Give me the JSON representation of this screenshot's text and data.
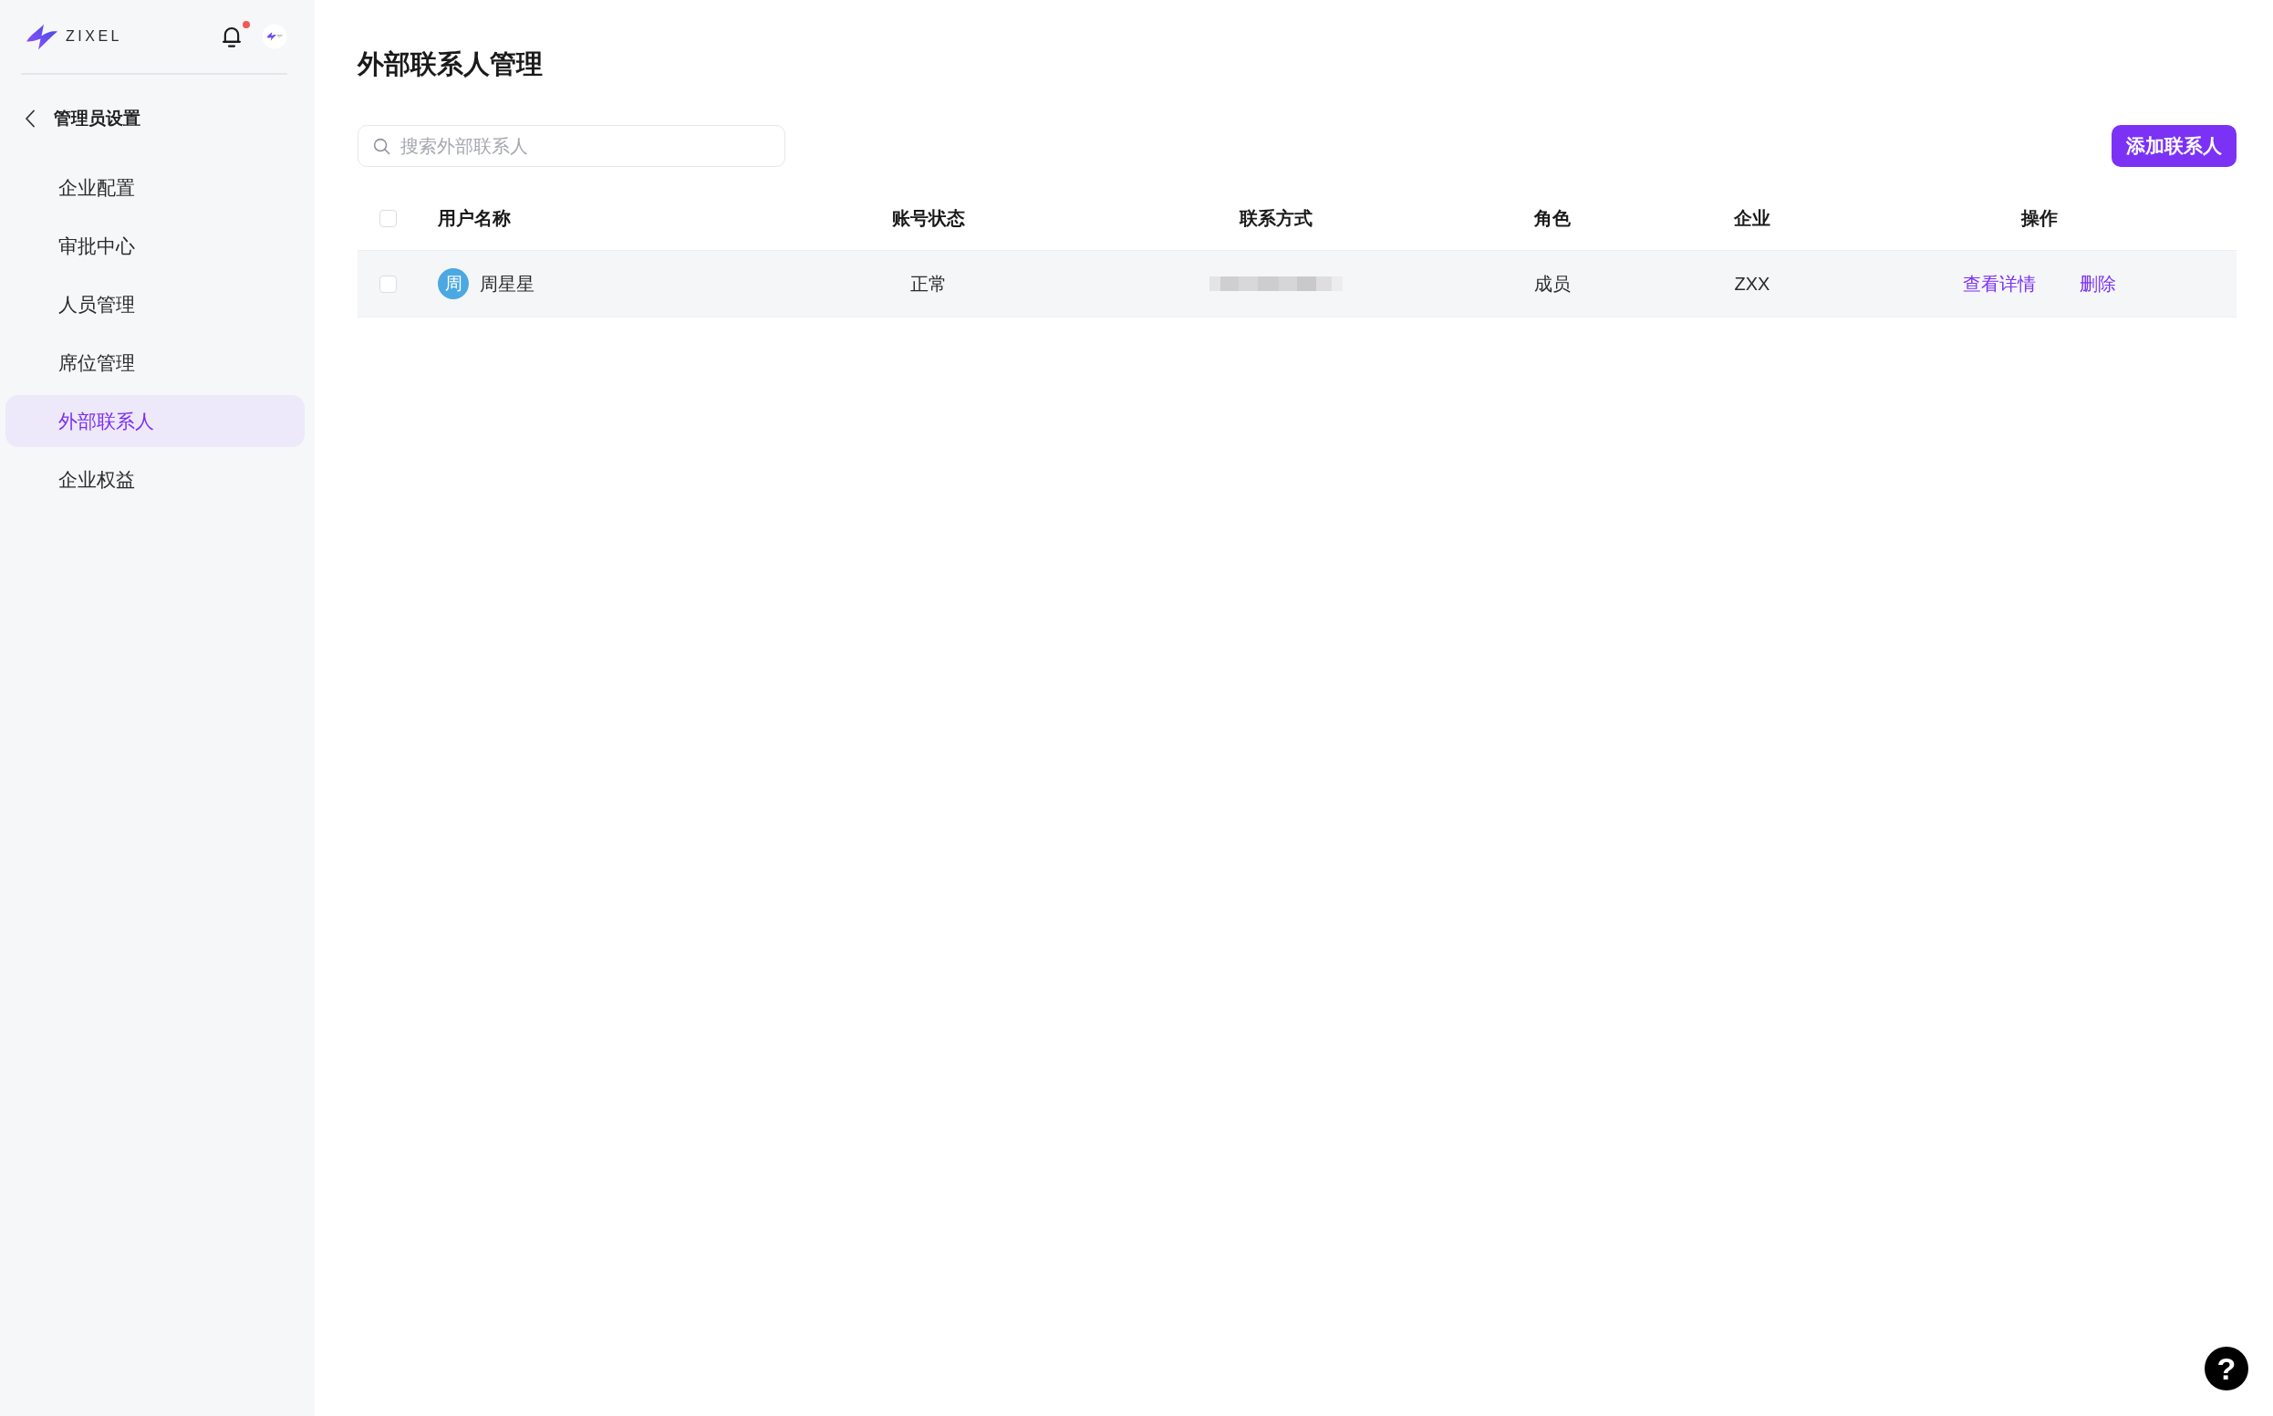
{
  "sidebar": {
    "logo": {
      "wordmark": "ZIXEL"
    },
    "notifications": {
      "unread": true
    },
    "back": {
      "label": "管理员设置"
    },
    "items": [
      {
        "label": "企业配置",
        "selected": false
      },
      {
        "label": "审批中心",
        "selected": false
      },
      {
        "label": "人员管理",
        "selected": false
      },
      {
        "label": "席位管理",
        "selected": false
      },
      {
        "label": "外部联系人",
        "selected": true
      },
      {
        "label": "企业权益",
        "selected": false
      }
    ]
  },
  "page": {
    "title": "外部联系人管理"
  },
  "toolbar": {
    "search": {
      "placeholder": "搜索外部联系人"
    },
    "add_button": {
      "label": "添加联系人"
    }
  },
  "table": {
    "select_all": {
      "checked": false
    },
    "columns": [
      "用户名称",
      "账号状态",
      "联系方式",
      "角色",
      "企业",
      "操作"
    ],
    "rows": [
      {
        "checked": false,
        "cells": [
          {
            "kind": "user",
            "avatar": "周",
            "name": "周星星"
          },
          {
            "kind": "text",
            "text": "正常"
          },
          {
            "kind": "redacted"
          },
          {
            "kind": "text",
            "text": "成员"
          },
          {
            "kind": "text",
            "text": "ZXX"
          },
          {
            "kind": "actions",
            "actions": [
              "查看详情",
              "删除"
            ]
          }
        ]
      }
    ]
  },
  "help_button": {
    "label": "?"
  }
}
